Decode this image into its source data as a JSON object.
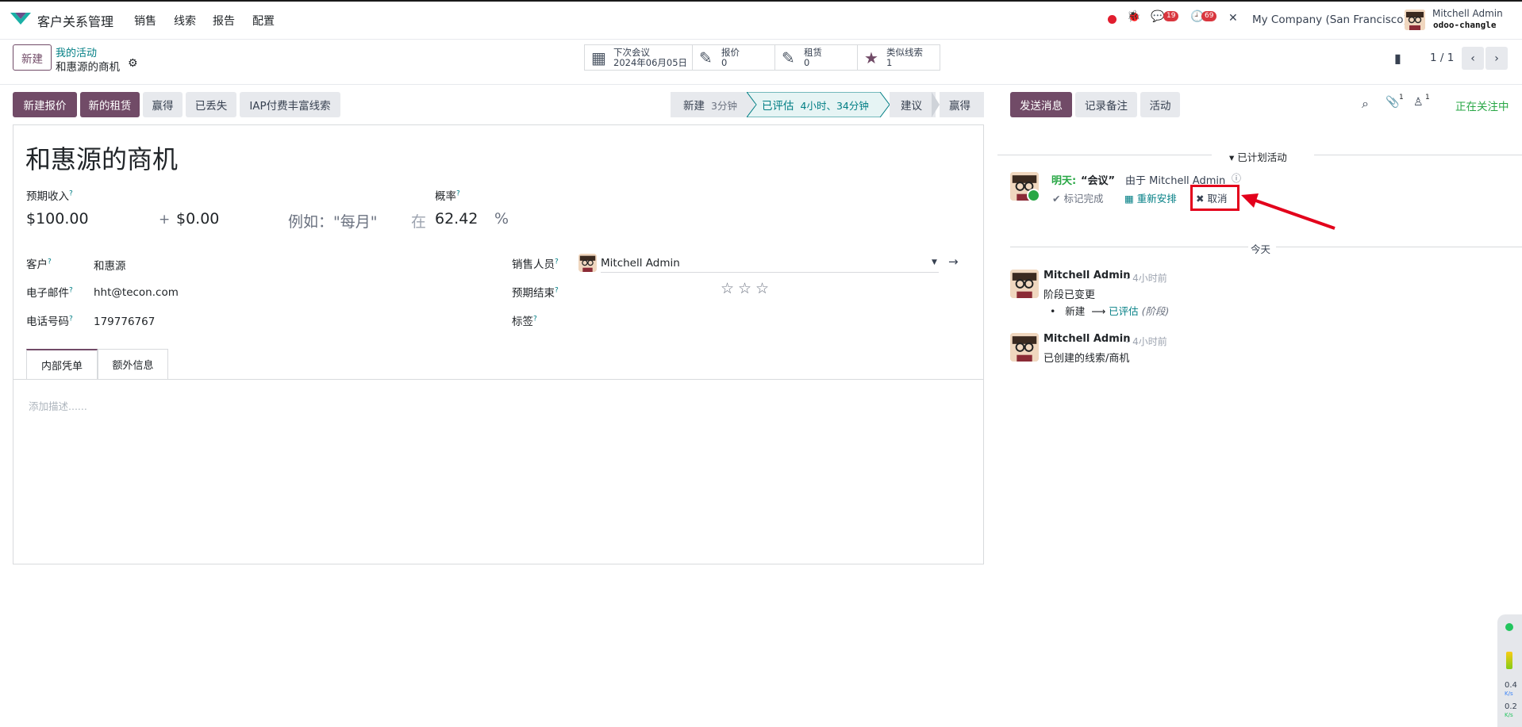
{
  "header": {
    "app_name": "客户关系管理",
    "menu": [
      "销售",
      "线索",
      "报告",
      "配置"
    ],
    "messages_count": "19",
    "activities_count": "69",
    "company": "My Company (San Francisco)",
    "user_name": "Mitchell Admin",
    "database": "odoo-changle"
  },
  "control": {
    "new_label": "新建",
    "breadcrumb_parent": "我的活动",
    "breadcrumb_current": "和惠源的商机",
    "pager": "1 / 1"
  },
  "smart_buttons": [
    {
      "icon": "calendar-icon",
      "label": "下次会议",
      "value": "2024年06月05日"
    },
    {
      "icon": "edit-icon",
      "label": "报价",
      "value": "0"
    },
    {
      "icon": "edit-icon",
      "label": "租赁",
      "value": "0"
    },
    {
      "icon": "star-icon",
      "label": "类似线索",
      "value": "1"
    }
  ],
  "actions": {
    "new_quote": "新建报价",
    "new_rental": "新的租赁",
    "won": "赢得",
    "lost": "已丢失",
    "iap": "IAP付费丰富线索"
  },
  "stages": [
    {
      "label": "新建",
      "duration": "3分钟"
    },
    {
      "label": "已评估",
      "duration": "4小时、34分钟",
      "active": true
    },
    {
      "label": "建议",
      "duration": ""
    },
    {
      "label": "赢得",
      "duration": ""
    }
  ],
  "form": {
    "title": "和惠源的商机",
    "expected_revenue_label": "预期收入",
    "expected_revenue": "$100.00",
    "plus": "+",
    "recurring": "$0.00",
    "recurring_placeholder": "例如：\"每月\"",
    "at": "在",
    "probability_label": "概率",
    "probability": "62.42",
    "percent": "%",
    "customer_label": "客户",
    "customer": "和惠源",
    "email_label": "电子邮件",
    "email": "hht@tecon.com",
    "phone_label": "电话号码",
    "phone": "179776767",
    "salesperson_label": "销售人员",
    "salesperson": "Mitchell Admin",
    "expected_closing_label": "预期结束",
    "tags_label": "标签",
    "priority_stars": 0,
    "tabs": [
      "内部凭单",
      "额外信息"
    ],
    "description_placeholder": "添加描述......"
  },
  "chatter": {
    "send_message": "发送消息",
    "log_note": "记录备注",
    "activity": "活动",
    "attachments_count": "1",
    "followers_count": "1",
    "following": "正在关注中",
    "planned_header": "已计划活动",
    "activity_when": "明天:",
    "activity_name": "“会议”",
    "activity_by": "由于 Mitchell Admin",
    "mark_done": "标记完成",
    "reschedule": "重新安排",
    "cancel": "取消",
    "today_divider": "今天",
    "messages": [
      {
        "author": "Mitchell Admin",
        "time": "- 4小时前",
        "body": "阶段已变更",
        "change_from": "新建",
        "change_to": "已评估",
        "change_field": "(阶段)"
      },
      {
        "author": "Mitchell Admin",
        "time": "- 4小时前",
        "body": "已创建的线索/商机"
      }
    ]
  },
  "widget": {
    "val1": "0.4",
    "unit1": "K/s",
    "val2": "0.2",
    "unit2": "K/s"
  },
  "colors": {
    "brand": "#714b67",
    "link": "#017e84",
    "highlight": "#e3001b",
    "following": "#28a745"
  }
}
